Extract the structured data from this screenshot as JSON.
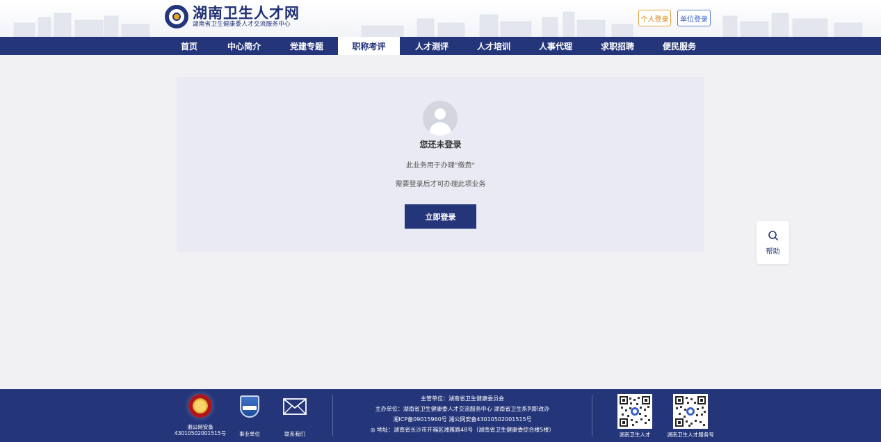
{
  "header": {
    "logo_title": "湖南卫生人才网",
    "logo_subtitle": "湖南省卫生健康委人才交流服务中心",
    "personal_login": "个人登录",
    "unit_login": "单位登录"
  },
  "nav": {
    "items": [
      "首页",
      "中心简介",
      "党建专题",
      "职称考评",
      "人才测评",
      "人才培训",
      "人事代理",
      "求职招聘",
      "便民服务"
    ],
    "active_index": 3
  },
  "main": {
    "title": "您还未登录",
    "line1": "此业务用于办理\"缴费\"",
    "line2": "需要登录后才可办理此项业务",
    "login_button": "立即登录"
  },
  "help": {
    "label": "帮助"
  },
  "footer": {
    "police_label_1": "湘公网安备",
    "police_label_2": "43010502001515号",
    "unit_label": "事业单位",
    "contact_label": "联系我们",
    "line1": "主管单位：湖南省卫生健康委员会",
    "line2": "主办单位：湖南省卫生健康委人才交流服务中心 湖南省卫生系列职改办",
    "line3": "湘ICP备09015960号 湘公网安备43010502001515号",
    "line4": "地址：湖南省长沙市开福区湘雅路48号（湖南省卫生健康委综合楼5楼）",
    "qr1_label": "湖南卫生人才",
    "qr2_label": "湖南卫生人才服务号"
  },
  "colors": {
    "primary": "#24357a",
    "personal_login": "#d68a16",
    "unit_login": "#3b62c6"
  },
  "icons": {
    "logo": "logo-emblem-icon",
    "avatar": "user-avatar-icon",
    "help": "search-icon",
    "police": "police-emblem-icon",
    "unit": "unit-badge-icon",
    "contact": "mail-icon",
    "address": "location-pin-icon"
  }
}
